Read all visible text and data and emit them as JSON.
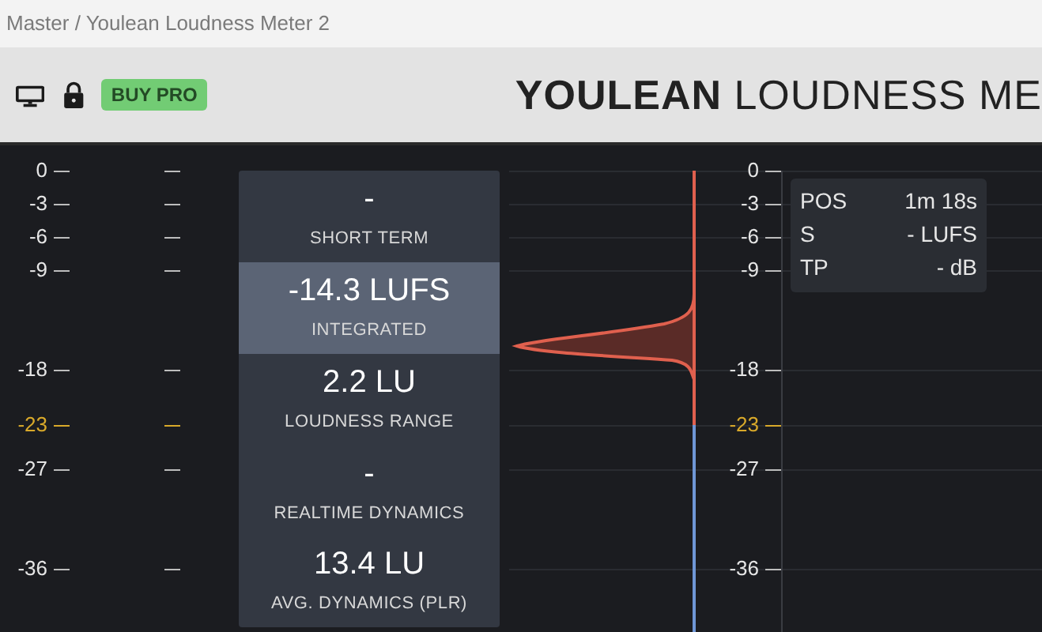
{
  "window": {
    "title": "Master / Youlean Loudness Meter 2"
  },
  "toolbar": {
    "buy_button": "BUY PRO",
    "brand_title": "**YOULEAN** LOUDNESS ME"
  },
  "left_scale": {
    "ticks": [
      {
        "label": "0",
        "kind": "normal"
      },
      {
        "label": "-3",
        "kind": "normal"
      },
      {
        "label": "-6",
        "kind": "normal"
      },
      {
        "label": "-9",
        "kind": "normal"
      },
      {
        "label": "-18",
        "kind": "normal"
      },
      {
        "label": "-23",
        "kind": "target"
      },
      {
        "label": "-27",
        "kind": "normal"
      },
      {
        "label": "-36",
        "kind": "normal"
      }
    ]
  },
  "panel": {
    "sections": [
      {
        "value": "-",
        "label": "SHORT TERM",
        "selected": false
      },
      {
        "value": "-14.3 LUFS",
        "label": "INTEGRATED",
        "selected": true
      },
      {
        "value": "2.2 LU",
        "label": "LOUDNESS RANGE",
        "selected": false
      },
      {
        "value": "-",
        "label": "REALTIME DYNAMICS",
        "selected": false
      },
      {
        "value": "13.4 LU",
        "label": "AVG. DYNAMICS (PLR)",
        "selected": false
      }
    ]
  },
  "right_scale": {
    "ticks": [
      {
        "label": "0",
        "kind": "normal"
      },
      {
        "label": "-3",
        "kind": "normal"
      },
      {
        "label": "-6",
        "kind": "normal"
      },
      {
        "label": "-9",
        "kind": "normal"
      },
      {
        "label": "-18",
        "kind": "normal"
      },
      {
        "label": "-23",
        "kind": "target"
      },
      {
        "label": "-27",
        "kind": "normal"
      },
      {
        "label": "-36",
        "kind": "normal"
      }
    ]
  },
  "info": {
    "rows": [
      {
        "key": "POS",
        "value": "1m 18s"
      },
      {
        "key": "S",
        "value": "- LUFS"
      },
      {
        "key": "TP",
        "value": "- dB"
      }
    ]
  }
}
